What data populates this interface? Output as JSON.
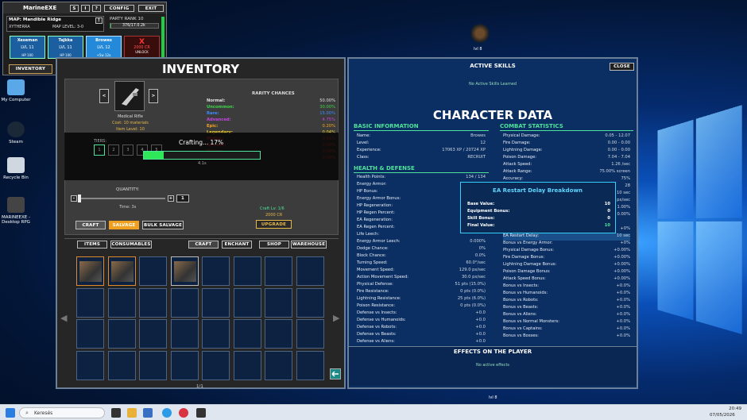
{
  "top": {
    "title": "MarineEXE",
    "btn_s": "S",
    "btn_i": "I",
    "btn_q": "?",
    "config": "CONFIG",
    "exit": "EXIT",
    "map": "MAP: Mandible Ridge",
    "region": "XYTHERRA",
    "map_level": "MAP LEVEL: 3-0",
    "party_rank": "PARTY RANK 10",
    "party_xp": "376/17.0.2k",
    "inventory_btn": "INVENTORY",
    "cards": [
      {
        "name": "Xeseman",
        "lvl": "LVL 11",
        "hp": "HP 100"
      },
      {
        "name": "Tajkka",
        "lvl": "LVL 11",
        "hp": "HP 100"
      },
      {
        "name": "Browes",
        "lvl": "LVL 12",
        "hp": "+5w 12a"
      }
    ],
    "unlock_x": "X",
    "unlock_cost": "2000 CR",
    "unlock_label": "UNLOCK"
  },
  "desktop": {
    "icons": [
      "My Computer",
      "Steam",
      "Recycle Bin",
      "MARINEEXE - Desktop RPG"
    ],
    "char_top_label": "lvl 8",
    "char_bottom_label": "lvl 8"
  },
  "inventory": {
    "title": "INVENTORY",
    "item_name": "Medical Rifle",
    "cost": "Cost: 10 materials",
    "item_level": "Item Level: 10",
    "rarity_title": "RARITY CHANCES",
    "rarities": [
      {
        "label": "Normal:",
        "value": "50.00%",
        "color": "#e0e0e0"
      },
      {
        "label": "Uncommon:",
        "value": "30.00%",
        "color": "#3fd24a"
      },
      {
        "label": "Rare:",
        "value": "15.00%",
        "color": "#3b8cff"
      },
      {
        "label": "Advanced:",
        "value": "4.75%",
        "color": "#c445e0"
      },
      {
        "label": "Epic:",
        "value": "0.20%",
        "color": "#f5a623"
      },
      {
        "label": "Legendary:",
        "value": "0.04%",
        "color": "#f5d123"
      },
      {
        "label": "Mythic:",
        "value": "0.01%",
        "color": "#ff4040"
      },
      {
        "label": "Ancient:",
        "value": "0.00%",
        "color": "#ff4040"
      },
      {
        "label": "Divine:",
        "value": "0.00%",
        "color": "#ff4040"
      },
      {
        "label": "Cosmic:",
        "value": "0.00%",
        "color": "#ff4040"
      }
    ],
    "tiers_label": "TIERS:",
    "tier_nums": [
      "1",
      "2",
      "3",
      "4",
      "5"
    ],
    "crafting_text": "Crafting... 17%",
    "craft_progress": 0.17,
    "time_small": "4.1s",
    "quantity_label": "QUANTITY:",
    "qty_minus": "-",
    "qty_plus": "+",
    "qty_value": "1",
    "time_label": "Time: 3s",
    "craft_lv": "Craft Lv: 1/6",
    "craft_cost": "2000 CR",
    "upgrade": "UPGRADE",
    "craft_btn": "CRAFT",
    "salvage_btn": "SALVAGE",
    "bulk_salvage_btn": "BULK SALVAGE",
    "tabs": [
      "ITEMS",
      "CONSUMABLES",
      "CRAFT",
      "ENCHANT",
      "SHOP",
      "WAREHOUSE"
    ],
    "page": "1/1",
    "left_arrow": "◀",
    "right_arrow": "▶"
  },
  "character": {
    "active_skills": "ACTIVE SKILLS",
    "close": "CLOSE",
    "no_skills": "No Active Skills Learned",
    "title": "CHARACTER DATA",
    "basic_title": "BASIC INFORMATION",
    "basic": [
      [
        "Name:",
        "Browes"
      ],
      [
        "Level:",
        "12"
      ],
      [
        "Experience:",
        "17063 XP / 20724 XP"
      ],
      [
        "Class:",
        "RECRUIT"
      ]
    ],
    "health_title": "HEALTH & DEFENSE",
    "health": [
      [
        "Health Points:",
        "134 / 134"
      ],
      [
        "Energy Armor:",
        ""
      ],
      [
        "HP Bonus:",
        ""
      ],
      [
        "Energy Armor Bonus:",
        ""
      ],
      [
        "HP Regeneration:",
        ""
      ],
      [
        "HP Regen Percent:",
        ""
      ],
      [
        "EA Regeneration:",
        ""
      ],
      [
        "EA Regen Percent:",
        ""
      ],
      [
        "Life Leech:",
        ""
      ],
      [
        "Energy Armor Leech:",
        "0.000%"
      ],
      [
        "Dodge Chance:",
        "0%"
      ],
      [
        "Block Chance:",
        "0.0%"
      ],
      [
        "Turning Speed:",
        "60.0°/sec"
      ],
      [
        "Movement Speed:",
        "129.0 px/sec"
      ],
      [
        "Action Movement Speed:",
        "30.0 px/sec"
      ],
      [
        "Physical Defense:",
        "51 pts (15.0%)"
      ],
      [
        "Fire Resistance:",
        "0 pts (0.0%)"
      ],
      [
        "Lightning Resistance:",
        "25 pts (6.0%)"
      ],
      [
        "Poison Resistance:",
        "0 pts (0.0%)"
      ],
      [
        "Defense vs Insects:",
        "+0.0"
      ],
      [
        "Defense vs Humanoids:",
        "+0.0"
      ],
      [
        "Defense vs Robots:",
        "+0.0"
      ],
      [
        "Defense vs Beasts:",
        "+0.0"
      ],
      [
        "Defense vs Aliens:",
        "+0.0"
      ]
    ],
    "combat_title": "COMBAT STATISTICS",
    "combat": [
      [
        "Physical Damage:",
        "0.05 - 12.07"
      ],
      [
        "Fire Damage:",
        "0.00 - 0.00"
      ],
      [
        "Lightning Damage:",
        "0.00 - 0.00"
      ],
      [
        "Poison Damage:",
        "7.04 - 7.04"
      ],
      [
        "Attack Speed:",
        "1.26 /sec"
      ],
      [
        "Attack Range:",
        "75.00% screen"
      ],
      [
        "Accuracy:",
        "75%"
      ],
      [
        "",
        "28"
      ],
      [
        "",
        "10 sec"
      ],
      [
        "",
        "px/sec"
      ],
      [
        "",
        "1.00%"
      ],
      [
        "",
        "0.00%"
      ],
      [
        "",
        ""
      ],
      [
        "",
        "+0%"
      ],
      [
        "EA Restart Delay:",
        "10 sec"
      ],
      [
        "Bonus vs Energy Armor:",
        "+0%"
      ],
      [
        "Physical Damage Bonus:",
        "+0.00%"
      ],
      [
        "Fire Damage Bonus:",
        "+0.00%"
      ],
      [
        "Lightning Damage Bonus:",
        "+0.00%"
      ],
      [
        "Poison Damage Bonus:",
        "+0.00%"
      ],
      [
        "Attack Speed Bonus:",
        "+0.00%"
      ],
      [
        "Bonus vs Insects:",
        "+0.0%"
      ],
      [
        "Bonus vs Humanoids:",
        "+0.0%"
      ],
      [
        "Bonus vs Robots:",
        "+0.0%"
      ],
      [
        "Bonus vs Beasts:",
        "+0.0%"
      ],
      [
        "Bonus vs Aliens:",
        "+0.0%"
      ],
      [
        "Bonus vs Normal Monsters:",
        "+0.0%"
      ],
      [
        "Bonus vs Captains:",
        "+0.0%"
      ],
      [
        "Bonus vs Bosses:",
        "+0.0%"
      ]
    ],
    "tooltip": {
      "title": "EA Restart Delay Breakdown",
      "rows": [
        [
          "Base Value:",
          "10"
        ],
        [
          "Equipment Bonus:",
          "0"
        ],
        [
          "Skill Bonus:",
          "0"
        ],
        [
          "Final Value:",
          "10"
        ]
      ]
    },
    "effects_title": "EFFECTS ON THE PLAYER",
    "no_effects": "No active effects"
  },
  "taskbar": {
    "search": "Keresés",
    "time": "20:49",
    "date": "07/05/2026"
  }
}
